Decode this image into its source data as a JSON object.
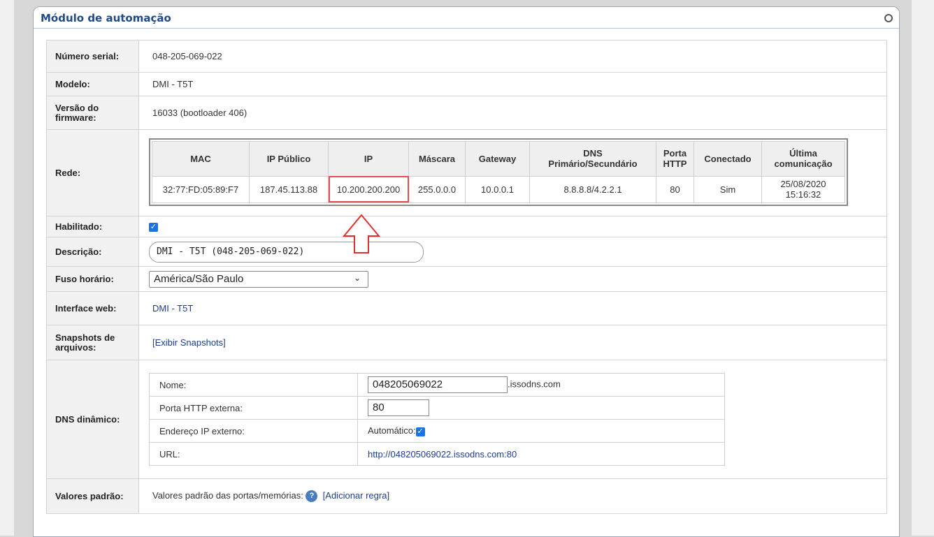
{
  "title": "Módulo de automação",
  "fields": {
    "serial_label": "Número serial:",
    "serial_value": "048-205-069-022",
    "model_label": "Modelo:",
    "model_value": "DMI - T5T",
    "firmware_label": "Versão do firmware:",
    "firmware_value": "16033 (bootloader 406)",
    "network_label": "Rede:",
    "enabled_label": "Habilitado:",
    "description_label": "Descrição:",
    "description_value": "DMI - T5T (048-205-069-022)",
    "timezone_label": "Fuso horário:",
    "timezone_value": "América/São Paulo",
    "webui_label": "Interface web:",
    "webui_link": "DMI - T5T",
    "snapshots_label": "Snapshots de arquivos:",
    "snapshots_link": "[Exibir Snapshots]",
    "ddns_label": "DNS dinâmico:",
    "defaults_label": "Valores padrão:",
    "defaults_text": "Valores padrão das portas/memórias:",
    "defaults_link": "[Adicionar regra]"
  },
  "network": {
    "headers": {
      "mac": "MAC",
      "public_ip": "IP Público",
      "ip": "IP",
      "mask": "Máscara",
      "gateway": "Gateway",
      "dns_line1": "DNS",
      "dns_line2": "Primário/Secundário",
      "port_line1": "Porta",
      "port_line2": "HTTP",
      "connected": "Conectado",
      "last_line1": "Última",
      "last_line2": "comunicação"
    },
    "row": {
      "mac": "32:77:FD:05:89:F7",
      "public_ip": "187.45.113.88",
      "ip": "10.200.200.200",
      "mask": "255.0.0.0",
      "gateway": "10.0.0.1",
      "dns": "8.8.8.8/4.2.2.1",
      "port": "80",
      "connected": "Sim",
      "last_date": "25/08/2020",
      "last_time": "15:16:32"
    }
  },
  "ddns": {
    "name_label": "Nome:",
    "name_value": "048205069022",
    "name_suffix": ".issodns.com",
    "port_label": "Porta HTTP externa:",
    "port_value": "80",
    "ext_ip_label": "Endereço IP externo:",
    "ext_ip_value": "Automático:",
    "url_label": "URL:",
    "url_value": "http://048205069022.issodns.com:80"
  },
  "colors": {
    "title": "#1f4a84",
    "link": "#1f3d8a",
    "highlight": "#e05050",
    "checkbox": "#1a73e8"
  },
  "icons": {
    "help": "help-icon",
    "close": "close-icon",
    "arrow": "up-arrow-annotation"
  }
}
